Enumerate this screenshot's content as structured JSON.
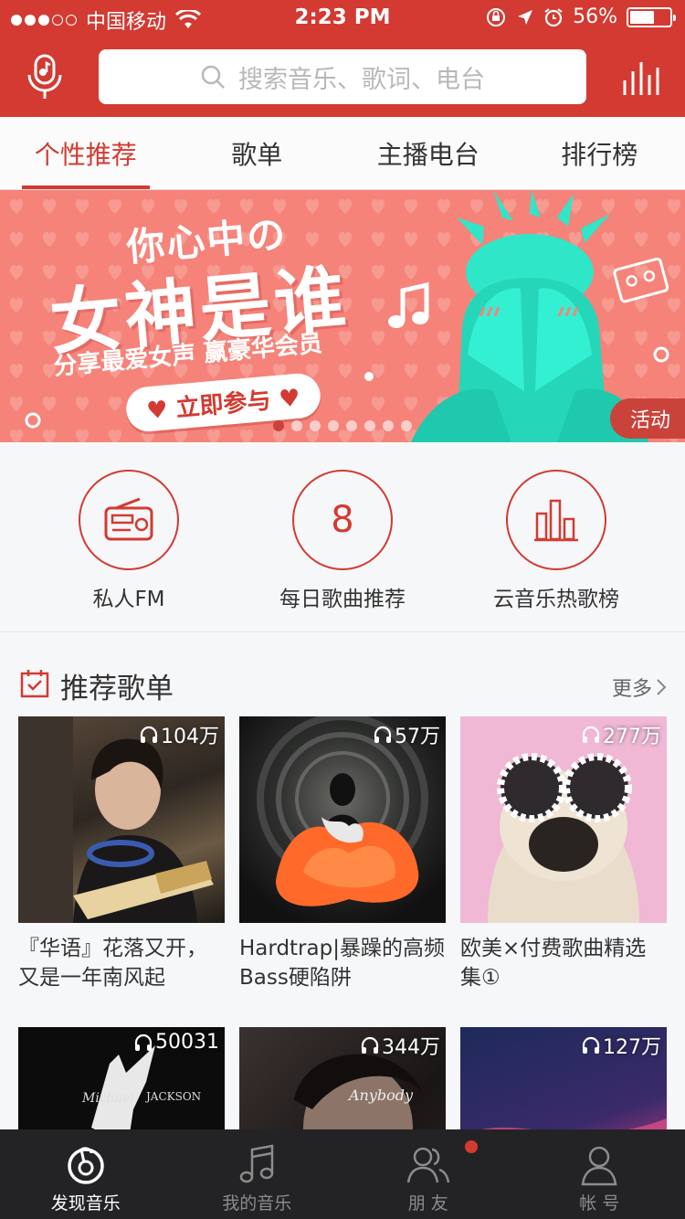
{
  "status_bar": {
    "carrier": "中国移动",
    "time": "2:23 PM",
    "battery": "56%"
  },
  "search": {
    "placeholder": "搜索音乐、歌词、电台"
  },
  "tabs": [
    {
      "label": "个性推荐",
      "active": true
    },
    {
      "label": "歌单",
      "active": false
    },
    {
      "label": "主播电台",
      "active": false
    },
    {
      "label": "排行榜",
      "active": false
    }
  ],
  "banner": {
    "line1": "你心中の",
    "line2": "女神是谁",
    "line3": "分享最爱女声  赢豪华会员",
    "cta": "立即参与",
    "tag": "活动",
    "pages": 8,
    "current_page": 1
  },
  "quick": {
    "fm_label": "私人FM",
    "daily_number": "8",
    "daily_label": "每日歌曲推荐",
    "chart_label": "云音乐热歌榜"
  },
  "section": {
    "title": "推荐歌单",
    "more": "更多"
  },
  "playlists": [
    {
      "count": "104万",
      "title": "『华语』花落又开，又是一年南风起"
    },
    {
      "count": "57万",
      "title": "Hardtrap|暴躁的高频Bass硬陷阱"
    },
    {
      "count": "277万",
      "title": "欧美×付费歌曲精选集①"
    },
    {
      "count": "50031",
      "title": ""
    },
    {
      "count": "344万",
      "title": ""
    },
    {
      "count": "127万",
      "title": ""
    }
  ],
  "tabbar": {
    "discover": "发现音乐",
    "my_music": "我的音乐",
    "friends": "朋 友",
    "account": "帐 号"
  },
  "colors": {
    "brand_red": "#d33a31",
    "banner_pink": "#f5837a",
    "tabbar_bg": "#232326"
  }
}
